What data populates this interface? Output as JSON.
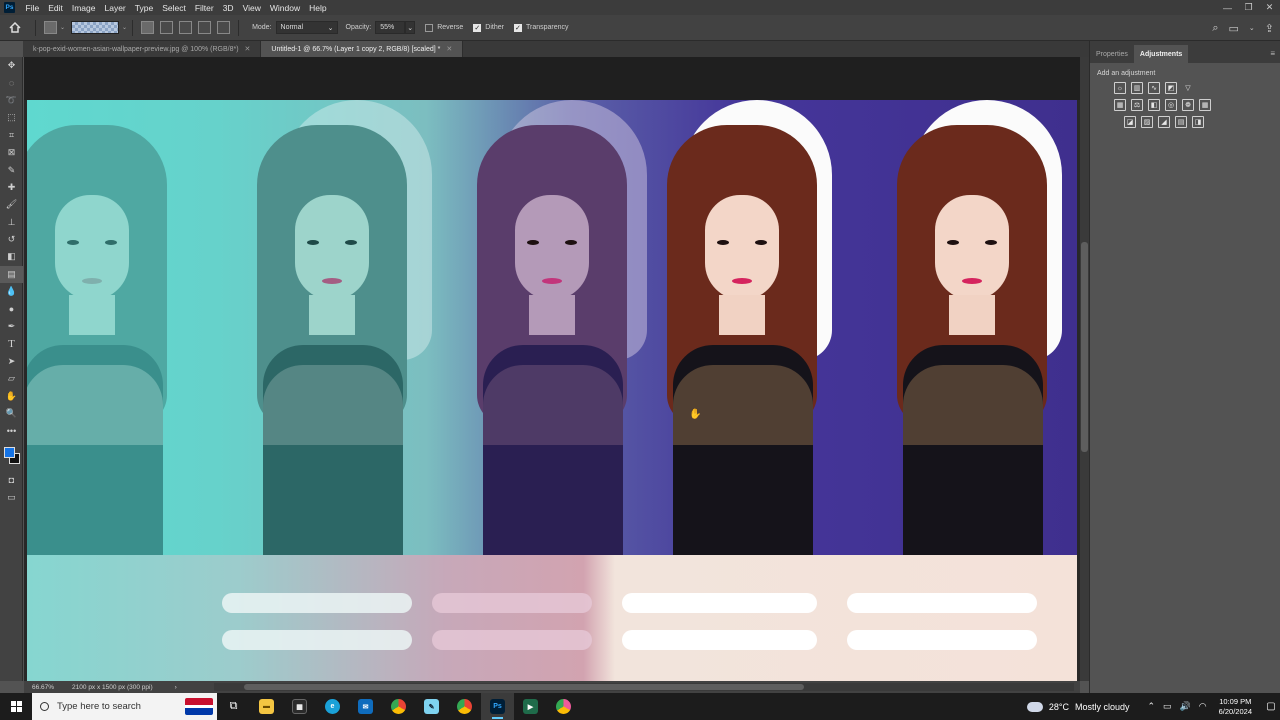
{
  "menubar": {
    "app_icon": "Ps",
    "items": [
      "File",
      "Edit",
      "Image",
      "Layer",
      "Type",
      "Select",
      "Filter",
      "3D",
      "View",
      "Window",
      "Help"
    ]
  },
  "options": {
    "mode_label": "Mode:",
    "mode_value": "Normal",
    "opacity_label": "Opacity:",
    "opacity_value": "55%",
    "reverse_label": "Reverse",
    "dither_label": "Dither",
    "transparency_label": "Transparency",
    "reverse_checked": false,
    "dither_checked": true,
    "transparency_checked": true
  },
  "tabs": [
    {
      "label": "k-pop-exid-women-asian-wallpaper-preview.jpg @ 100% (RGB/8*)",
      "active": false
    },
    {
      "label": "Untitled-1 @ 66.7% (Layer 1 copy 2, RGB/8) [scaled] *",
      "active": true
    }
  ],
  "colors": {
    "foreground": "#1473e6",
    "background": "#111111"
  },
  "status": {
    "zoom": "66.67%",
    "doc_size": "2100 px x 1500 px (300 ppi)"
  },
  "panel": {
    "tabs": [
      "Properties",
      "Adjustments"
    ],
    "active_tab": "Adjustments",
    "add_adjustment_label": "Add an adjustment"
  },
  "taskbar": {
    "search_placeholder": "Type here to search",
    "weather_temp": "28°C",
    "weather_text": "Mostly cloudy",
    "time": "10:09 PM",
    "date": "6/20/2024"
  }
}
